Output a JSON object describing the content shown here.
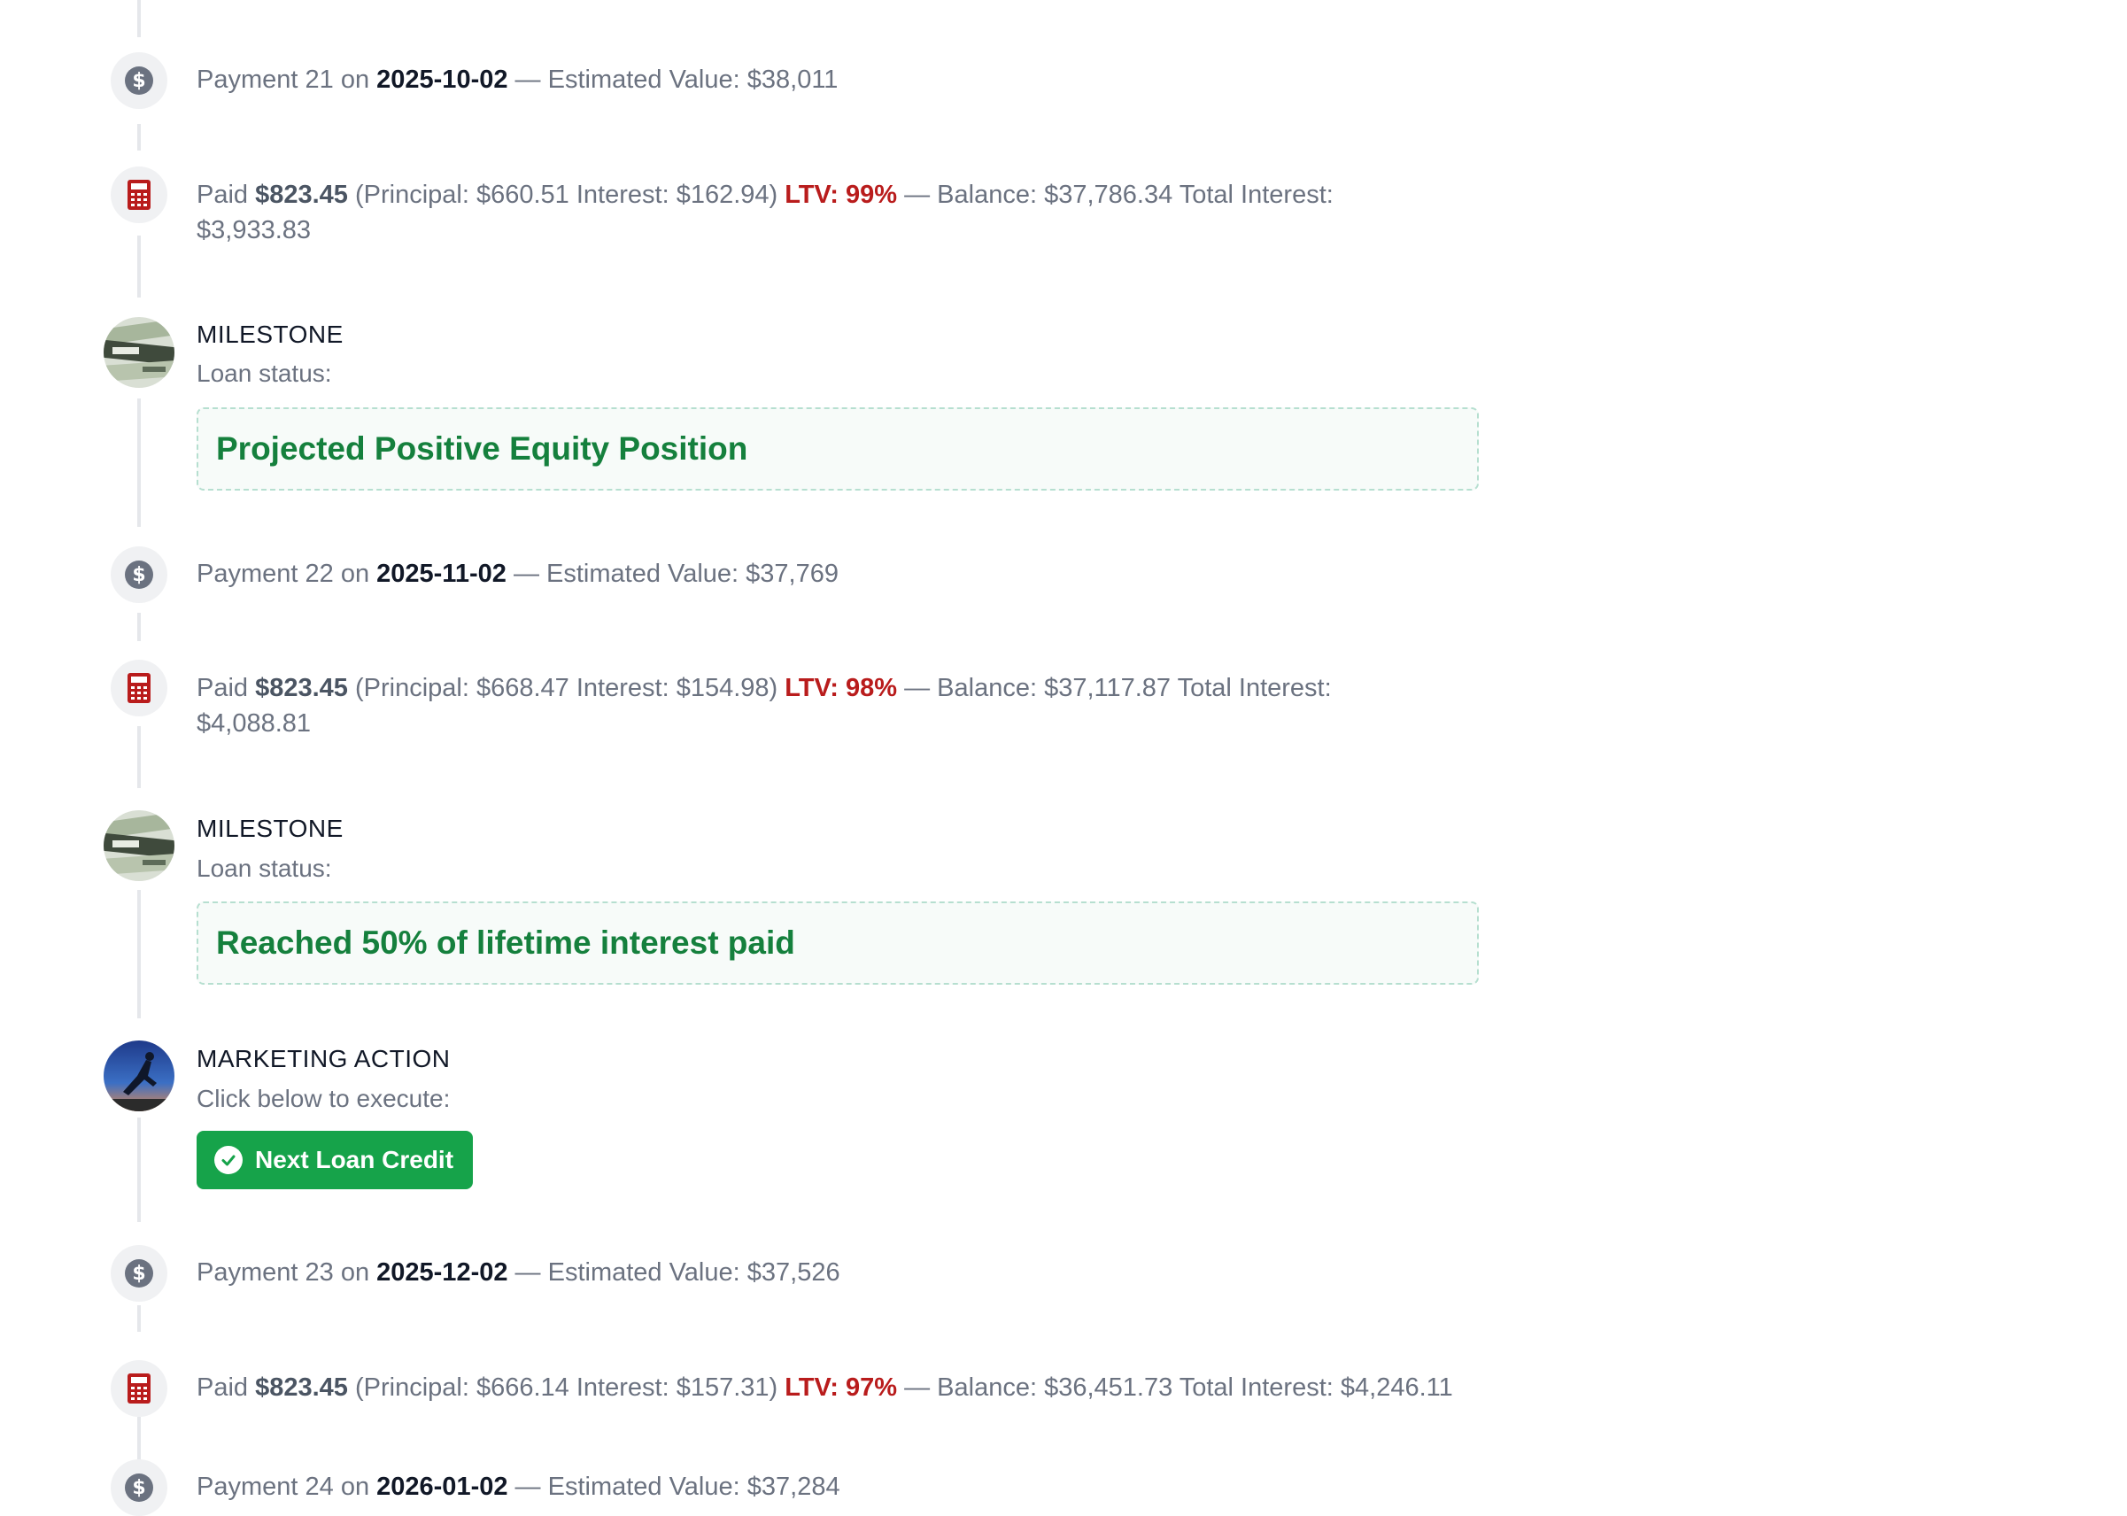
{
  "events": {
    "p21": {
      "label": "Payment 21 on",
      "date": "2025-10-02",
      "sep": "— Estimated Value:",
      "value": "$38,011"
    },
    "c21": {
      "paid_label": "Paid",
      "amount": "$823.45",
      "detail": "(Principal: $660.51 Interest: $162.94)",
      "ltv": "LTV: 99%",
      "tail": "— Balance: $37,786.34 Total Interest: $3,933.83"
    },
    "m1": {
      "title": "MILESTONE",
      "sub": "Loan status:",
      "status": "Projected Positive Equity Position"
    },
    "p22": {
      "label": "Payment 22 on",
      "date": "2025-11-02",
      "sep": "— Estimated Value:",
      "value": "$37,769"
    },
    "c22": {
      "paid_label": "Paid",
      "amount": "$823.45",
      "detail": "(Principal: $668.47 Interest: $154.98)",
      "ltv": "LTV: 98%",
      "tail": "— Balance: $37,117.87 Total Interest: $4,088.81"
    },
    "m2": {
      "title": "MILESTONE",
      "sub": "Loan status:",
      "status": "Reached 50% of lifetime interest paid"
    },
    "ma": {
      "title": "MARKETING ACTION",
      "sub": "Click below to execute:",
      "button": "Next Loan Credit"
    },
    "p23": {
      "label": "Payment 23 on",
      "date": "2025-12-02",
      "sep": "— Estimated Value:",
      "value": "$37,526"
    },
    "c23": {
      "paid_label": "Paid",
      "amount": "$823.45",
      "detail": "(Principal: $666.14 Interest: $157.31)",
      "ltv": "LTV: 97%",
      "tail": "— Balance: $36,451.73 Total Interest: $4,246.11"
    },
    "p24": {
      "label": "Payment 24 on",
      "date": "2026-01-02",
      "sep": "— Estimated Value:",
      "value": "$37,284"
    }
  },
  "colors": {
    "ltv": "#b91c1c",
    "status": "#15803d",
    "button": "#16a34a",
    "icon_calc": "#b91c1c",
    "icon_dollar": "#6b7280"
  },
  "icons": {
    "payment": "dollar-icon",
    "calc": "calculator-icon",
    "milestone": "money-avatar",
    "marketing": "jumper-avatar",
    "button": "check-circle-icon"
  }
}
